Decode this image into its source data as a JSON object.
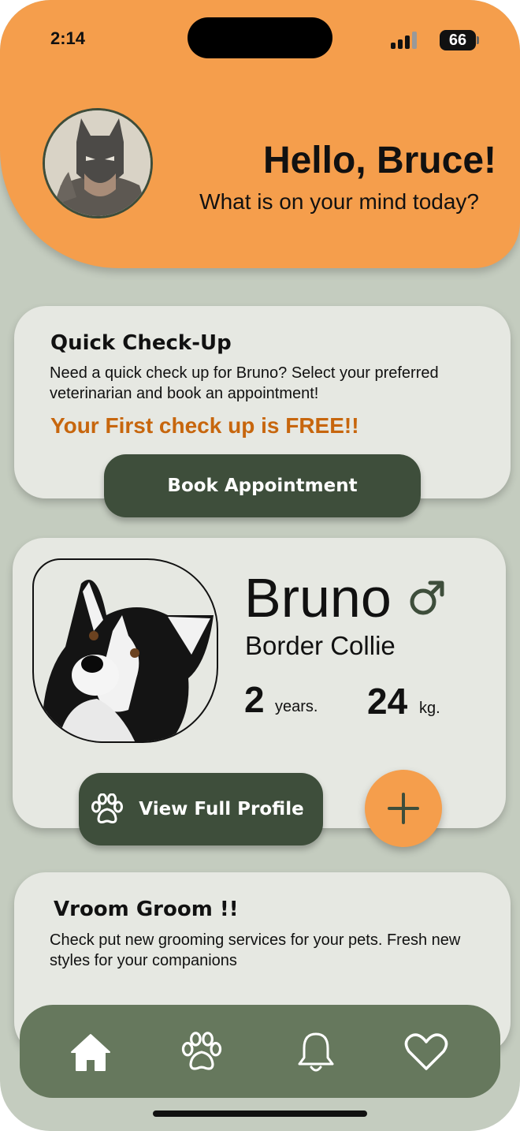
{
  "status_bar": {
    "time": "2:14",
    "battery": "66"
  },
  "header": {
    "greeting": "Hello, Bruce!",
    "subtitle": "What is on your mind today?",
    "avatar_icon": "user-avatar"
  },
  "checkup_card": {
    "title": "Quick Check-Up",
    "text": "Need a quick check up for Bruno? Select your preferred veterinarian and book an appointment!",
    "promo": "Your First check up is FREE!!",
    "button_label": "Book Appointment"
  },
  "pet_card": {
    "name": "Bruno",
    "gender_icon": "male-icon",
    "breed": "Border Collie",
    "age_value": "2",
    "age_unit": "years.",
    "weight_value": "24",
    "weight_unit": "kg.",
    "profile_button_label": "View Full Profile",
    "add_icon": "plus-icon"
  },
  "groom_card": {
    "title": "Vroom Groom !!",
    "text": "Check put new grooming services for your pets. Fresh new styles for your companions"
  },
  "nav": {
    "items": [
      "home-icon",
      "paw-icon",
      "bell-icon",
      "heart-icon"
    ]
  },
  "colors": {
    "accent_orange": "#f59e4c",
    "dark_green": "#3e4e3b",
    "nav_green": "#66785d",
    "promo_orange": "#c7660d",
    "background": "#c4ccbf",
    "card": "#e6e8e2"
  }
}
